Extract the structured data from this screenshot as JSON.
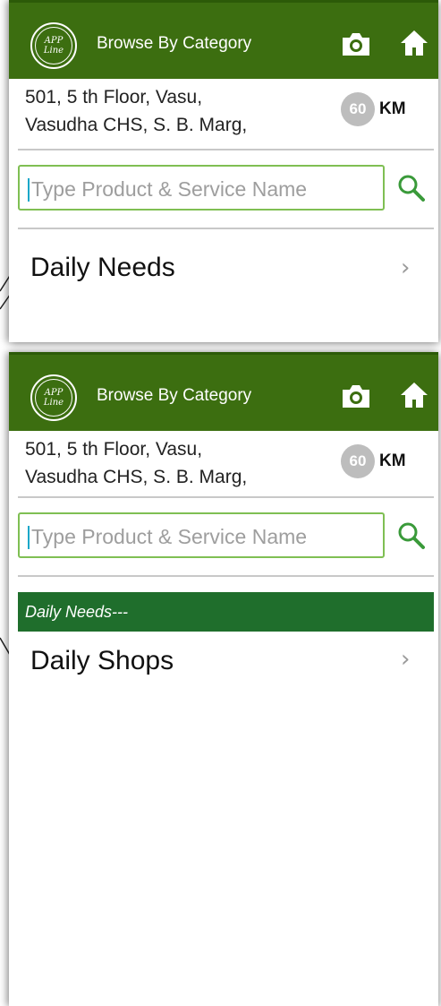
{
  "app_bar": {
    "logo_text": "APP Line",
    "title": "Browse By Category",
    "camera_icon": "camera-icon",
    "home_icon": "home-icon",
    "color": "#3c6e10"
  },
  "location": {
    "address_line1": "501, 5 th Floor, Vasu,",
    "address_line2": "Vasudha CHS, S. B. Marg,",
    "distance_value": "60",
    "distance_unit": "KM"
  },
  "search": {
    "placeholder": "Type Product & Service Name",
    "icon": "search-icon",
    "border_color": "#7fbf53"
  },
  "screen1": {
    "category_item": "Daily Needs"
  },
  "screen2": {
    "breadcrumb": "Daily Needs---",
    "category_item": "Daily Shops",
    "breadcrumb_color": "#1f6e2c"
  }
}
